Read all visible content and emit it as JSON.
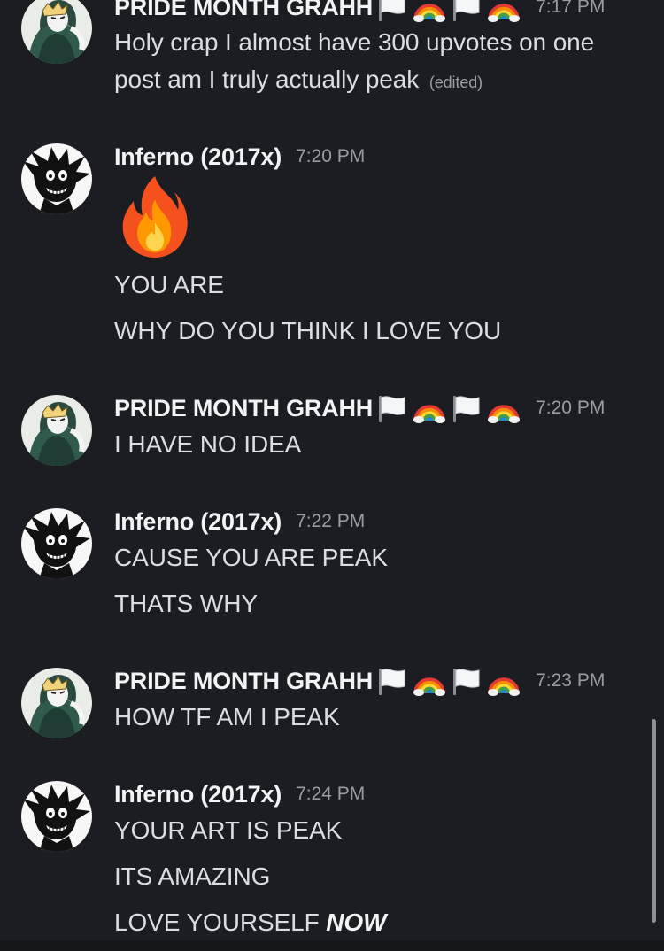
{
  "messages": [
    {
      "author": "PRIDE MONTH GRAHH",
      "time": "7:17 PM",
      "lines": [
        "Holy crap I almost have 300 upvotes on one",
        "post am I truly actually peak"
      ],
      "edited_label": "(edited)",
      "avatar": "pale-haired-character-avatar"
    },
    {
      "author": "Inferno (2017x)",
      "time": "7:20 PM",
      "emoji": "fire-emoji",
      "lines": [
        "YOU ARE",
        "WHY DO YOU THINK I LOVE YOU"
      ],
      "avatar": "dark-hedgehog-avatar"
    },
    {
      "author": "PRIDE MONTH GRAHH",
      "time": "7:20 PM",
      "lines": [
        "I HAVE NO IDEA"
      ],
      "avatar": "pale-haired-character-avatar"
    },
    {
      "author": "Inferno (2017x)",
      "time": "7:22 PM",
      "lines": [
        "CAUSE YOU ARE PEAK",
        "THATS WHY"
      ],
      "avatar": "dark-hedgehog-avatar"
    },
    {
      "author": "PRIDE MONTH GRAHH",
      "time": "7:23 PM",
      "lines": [
        "HOW TF AM I PEAK"
      ],
      "avatar": "pale-haired-character-avatar"
    },
    {
      "author": "Inferno (2017x)",
      "time": "7:24 PM",
      "lines": [
        "YOUR ART IS PEAK",
        "ITS AMAZING",
        "LOVE YOURSELF"
      ],
      "emphasis": "NOW",
      "avatar": "dark-hedgehog-avatar"
    }
  ],
  "name_emojis": [
    "white-flag-emoji",
    "rainbow-emoji",
    "white-flag-emoji",
    "rainbow-emoji"
  ],
  "colors": {
    "background": "#1c1d22",
    "username": "#f2f3f5",
    "text": "#dcdde1",
    "muted": "#9a9ca4"
  }
}
